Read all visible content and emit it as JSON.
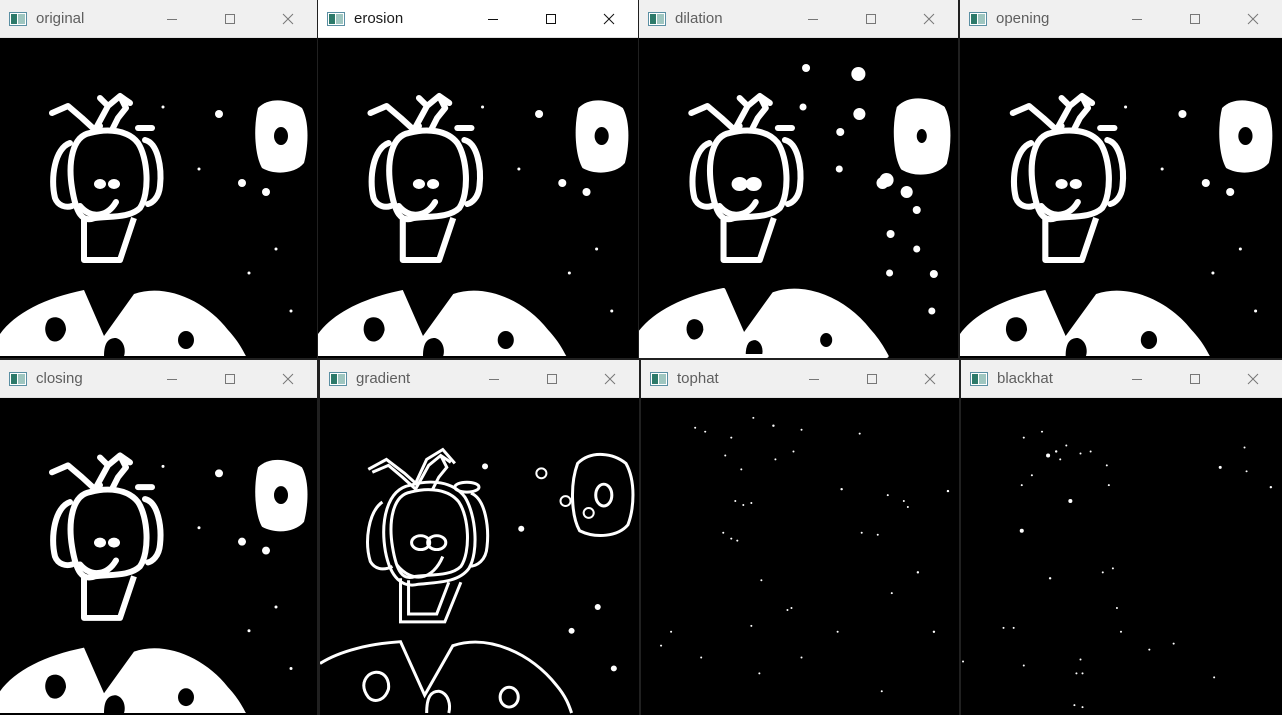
{
  "windows": [
    {
      "title": "original",
      "active": false
    },
    {
      "title": "erosion",
      "active": true
    },
    {
      "title": "dilation",
      "active": false
    },
    {
      "title": "opening",
      "active": false
    },
    {
      "title": "closing",
      "active": false
    },
    {
      "title": "gradient",
      "active": false
    },
    {
      "title": "tophat",
      "active": false
    },
    {
      "title": "blackhat",
      "active": false
    }
  ],
  "icons": {
    "app": "image-window-icon",
    "minimize": "minimize-icon",
    "maximize": "maximize-icon",
    "close": "close-icon"
  },
  "colors": {
    "titlebar_inactive": "#f0f0f0",
    "titlebar_active": "#ffffff",
    "canvas": "#000000",
    "foreground": "#ffffff"
  }
}
